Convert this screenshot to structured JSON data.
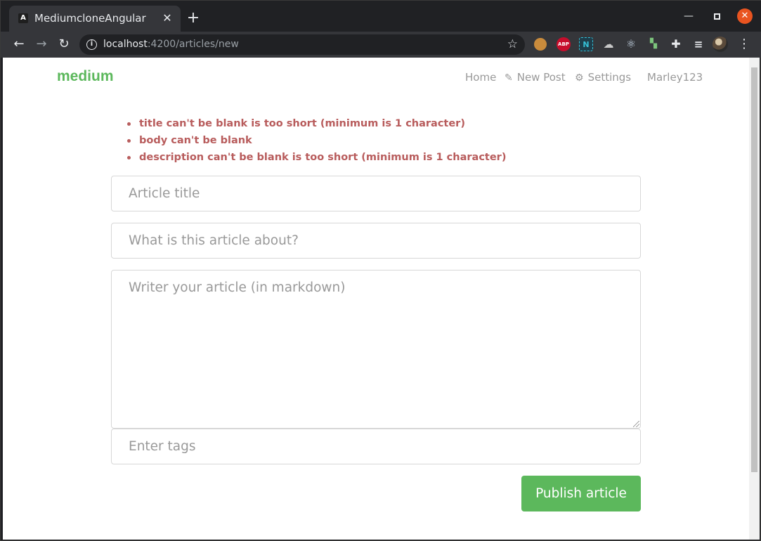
{
  "browser": {
    "tab": {
      "title": "MediumcloneAngular",
      "favicon": "A"
    },
    "url": {
      "host": "localhost",
      "path": ":4200/articles/new"
    },
    "extensions": [
      "cookie-icon",
      "adblock-icon",
      "n-extension-icon",
      "cloud-icon",
      "react-devtools-icon",
      "redux-devtools-icon",
      "puzzle-icon",
      "media-icon"
    ]
  },
  "navbar": {
    "brand": "medium",
    "links": {
      "home": "Home",
      "new_post": "New Post",
      "settings": "Settings",
      "user": "Marley123"
    }
  },
  "errors": [
    "title can't be blank is too short (minimum is 1 character)",
    "body can't be blank",
    "description can't be blank is too short (minimum is 1 character)"
  ],
  "form": {
    "title_placeholder": "Article title",
    "description_placeholder": "What is this article about?",
    "body_placeholder": "Writer your article (in markdown)",
    "tags_placeholder": "Enter tags",
    "submit_label": "Publish article"
  },
  "colors": {
    "brand": "#5cb85c",
    "error": "#b85c5c",
    "muted": "#999999"
  }
}
